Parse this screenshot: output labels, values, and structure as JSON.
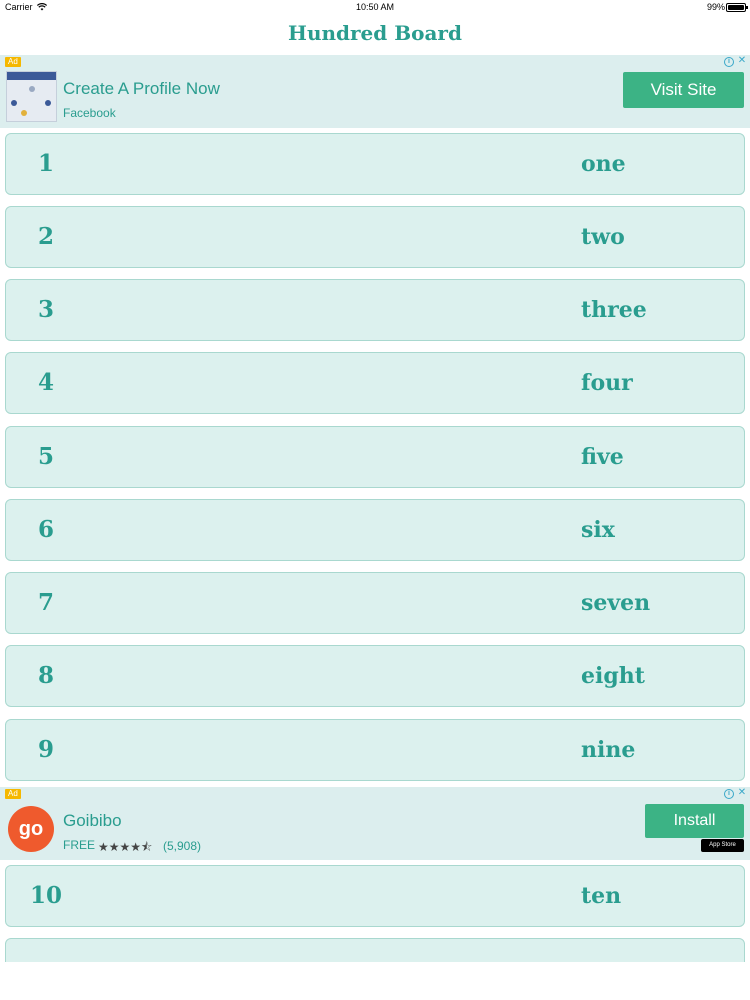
{
  "status_bar": {
    "carrier": "Carrier",
    "time": "10:50 AM",
    "battery": "99%",
    "icons": [
      "wifi-icon",
      "battery-icon"
    ]
  },
  "nav": {
    "title": "Hundred Board"
  },
  "ads": {
    "top": {
      "tag": "Ad",
      "title": "Create A Profile Now",
      "subtitle": "Facebook",
      "button": "Visit Site"
    },
    "middle": {
      "tag": "Ad",
      "title": "Goibibo",
      "price": "FREE",
      "stars": "★★★★⯪",
      "rating_count": "(5,908)",
      "button": "Install",
      "logo_text": "go",
      "badge": "App Store"
    }
  },
  "rows": [
    {
      "number": "1",
      "word": "one"
    },
    {
      "number": "2",
      "word": "two"
    },
    {
      "number": "3",
      "word": "three"
    },
    {
      "number": "4",
      "word": "four"
    },
    {
      "number": "5",
      "word": "five"
    },
    {
      "number": "6",
      "word": "six"
    },
    {
      "number": "7",
      "word": "seven"
    },
    {
      "number": "8",
      "word": "eight"
    },
    {
      "number": "9",
      "word": "nine"
    },
    {
      "number": "10",
      "word": "ten"
    }
  ],
  "colors": {
    "accent": "#2a9d8f",
    "row_bg": "#dcf1ee",
    "ad_bg": "#dceeee",
    "button": "#3cb385"
  }
}
